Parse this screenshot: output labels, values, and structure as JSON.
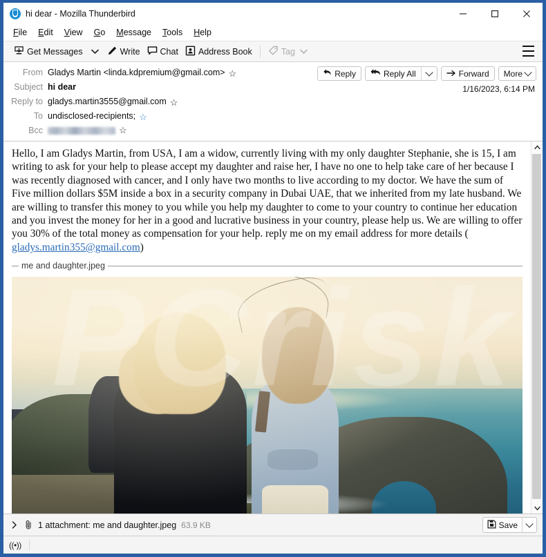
{
  "window": {
    "title": "hi dear - Mozilla Thunderbird",
    "app_icon": "thunderbird-icon",
    "minimize_label": "–",
    "maximize_label": "□",
    "close_label": "✕"
  },
  "menubar": {
    "items": [
      {
        "accel": "F",
        "rest": "ile"
      },
      {
        "accel": "E",
        "rest": "dit"
      },
      {
        "accel": "V",
        "rest": "iew"
      },
      {
        "accel": "G",
        "rest": "o"
      },
      {
        "accel": "M",
        "rest": "essage"
      },
      {
        "accel": "T",
        "rest": "ools"
      },
      {
        "accel": "H",
        "rest": "elp"
      }
    ]
  },
  "toolbar": {
    "get_messages_label": "Get Messages",
    "get_messages_icon": "inbox-download-icon",
    "get_messages_dropdown_icon": "chevron-down-icon",
    "write_label": "Write",
    "write_icon": "pencil-icon",
    "chat_label": "Chat",
    "chat_icon": "speech-bubble-icon",
    "address_book_label": "Address Book",
    "address_book_icon": "address-book-icon",
    "tag_label": "Tag",
    "tag_icon": "tag-icon",
    "tag_dropdown_icon": "chevron-down-icon",
    "app_menu_icon": "hamburger-menu-icon"
  },
  "message_header": {
    "rows": [
      {
        "label": "From",
        "value": "Gladys Martin <linda.kdpremium@gmail.com>",
        "bold": false,
        "star": "star-outline-icon",
        "star_color": "dark",
        "redacted": false
      },
      {
        "label": "Subject",
        "value": "hi dear",
        "bold": true,
        "star": null,
        "redacted": false
      },
      {
        "label": "Reply to",
        "value": "gladys.martin3555@gmail.com",
        "bold": false,
        "star": "star-outline-icon",
        "star_color": "dark",
        "redacted": false
      },
      {
        "label": "To",
        "value": "undisclosed-recipients;",
        "bold": false,
        "star": "star-outline-icon",
        "star_color": "blue",
        "redacted": false
      },
      {
        "label": "Bcc",
        "value": "",
        "bold": false,
        "star": "star-outline-icon",
        "star_color": "dark",
        "redacted": true
      }
    ],
    "date": "1/16/2023, 6:14 PM",
    "actions": {
      "reply_label": "Reply",
      "reply_icon": "reply-arrow-icon",
      "reply_all_label": "Reply All",
      "reply_all_icon": "reply-all-arrow-icon",
      "reply_all_dropdown_icon": "chevron-down-icon",
      "forward_label": "Forward",
      "forward_icon": "forward-arrow-icon",
      "more_label": "More",
      "more_dropdown_icon": "chevron-down-icon"
    }
  },
  "body": {
    "paragraph_part1": "   Hello, I am Gladys Martin, from USA, I am a widow, currently living with my only daughter Stephanie, she is 15, I am writing to ask for your help to please accept my daughter and raise her, I have no one to help  take care of her because I was recently diagnosed with cancer, and I only have two months to live  according to my doctor. We have  the sum of Five  million dollars $5M inside a box in a security company in Dubai UAE,  that we inherited from my late husband. We are willing to transfer this  money to you while you help my daughter to come to your country to continue her education and you invest the money for her in a good and lucrative business in your country,  please help us. We are willing to offer you 30% of the total money as compensation for your help. reply me on my email address for more details  ( ",
    "link_text": "gladys.martin355@gmail.com",
    "paragraph_part2": ")"
  },
  "inline_attachment": {
    "name": "me and daughter.jpeg",
    "photo_alt": "two people standing on a coastal clifftop with a sea arch in the background"
  },
  "watermark": {
    "text": "PCrisk"
  },
  "scrollbar": {
    "up_icon": "chevron-up-icon",
    "down_icon": "chevron-down-icon"
  },
  "attachment_bar": {
    "expand_icon": "chevron-right-icon",
    "paperclip_icon": "paperclip-icon",
    "text": "1 attachment: me and daughter.jpeg",
    "size": "63.9 KB",
    "save_label": "Save",
    "save_icon": "save-disk-icon",
    "save_dropdown_icon": "chevron-down-icon"
  },
  "statusbar": {
    "online_icon": "online-status-icon",
    "online_glyph": "((•))"
  },
  "colors": {
    "window_frame": "#2a5fa5",
    "toolbar_bg": "#f6f6f6",
    "label_gray": "#8d8d8d",
    "link_blue": "#2b6cb8",
    "star_blue": "#2f7fd1",
    "scrollbar_thumb": "#cdcdcd"
  }
}
